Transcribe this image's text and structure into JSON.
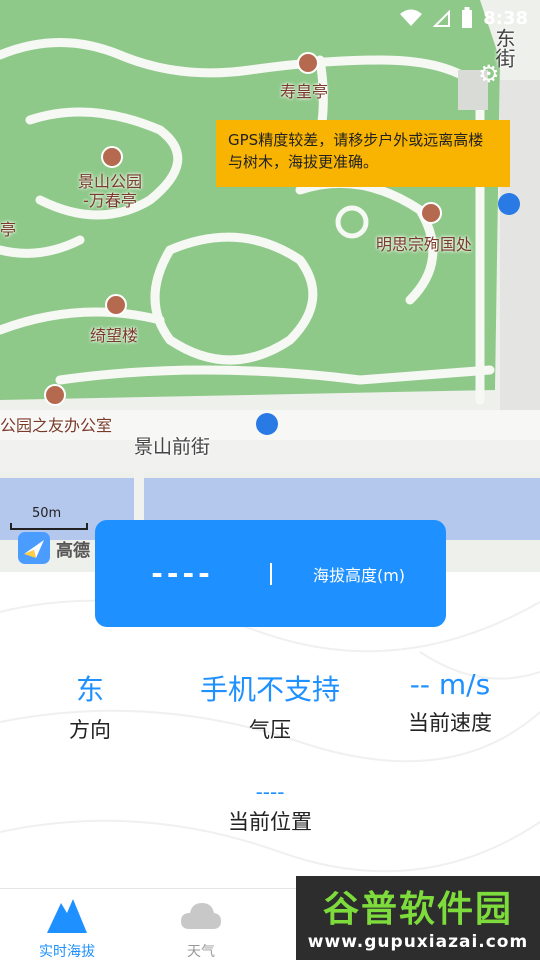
{
  "status_bar": {
    "time": "8:38",
    "icons": [
      "wifi-icon",
      "signal-icon",
      "battery-icon"
    ]
  },
  "map": {
    "pois": [
      {
        "id": "shouhuang",
        "label": "寿皇亭"
      },
      {
        "id": "wanchun",
        "label": "景山公园\n-万春亭"
      },
      {
        "id": "left-ting",
        "label": "亭"
      },
      {
        "id": "mingsi",
        "label": "明思宗殉国处"
      },
      {
        "id": "qiwang",
        "label": "绮望楼"
      },
      {
        "id": "office",
        "label": "公园之友办公室"
      }
    ],
    "road_top_right": "东街",
    "road_main": "景山前街",
    "scale": "50m",
    "provider": "高德",
    "tip": "GPS精度较差，请移步户外或远离高楼与树木，海拔更准确。"
  },
  "altitude": {
    "value": "----",
    "label": "海拔高度(m)"
  },
  "stats": {
    "direction": {
      "value": "东",
      "label": "方向"
    },
    "pressure": {
      "value": "手机不支持",
      "label": "气压"
    },
    "speed": {
      "value": "-- m/s",
      "label": "当前速度"
    },
    "location": {
      "value": "----",
      "label": "当前位置"
    }
  },
  "tabs": [
    {
      "label": "实时海拔",
      "icon": "mountain-icon",
      "active": true
    },
    {
      "label": "天气",
      "icon": "cloud-icon",
      "active": false
    }
  ],
  "watermark": {
    "brand": "谷普软件园",
    "url": "www.gupuxiazai.com"
  },
  "colors": {
    "accent": "#1e90ff",
    "tip_bg": "#f8b400",
    "park_green": "#8fc98a"
  }
}
